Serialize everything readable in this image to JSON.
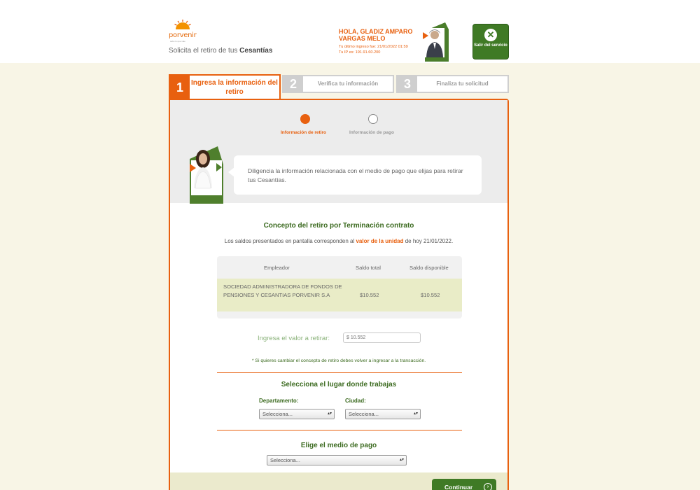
{
  "header": {
    "logo_text": "porvenir",
    "logo_tagline": "sabe lo que vale",
    "subtitle_prefix": "Solicita el retiro de tus ",
    "subtitle_bold": "Cesantías",
    "greeting_name": "Hola, GLADIZ AMPARO VARGAS MELO",
    "last_login": "Tu último ingreso fue: 21/01/2022 01:59",
    "ip": "Tu IP es: 191.91.60.200",
    "exit_label": "Salir del servicio"
  },
  "steps": [
    {
      "num": "1",
      "label": "Ingresa la información del retiro"
    },
    {
      "num": "2",
      "label": "Verifica tu información"
    },
    {
      "num": "3",
      "label": "Finaliza tu solicitud"
    }
  ],
  "progress": {
    "step_a": "Información de retiro",
    "step_b": "Información de pago"
  },
  "bubble_text": "Diligencia la información relacionada con el medio de pago que elijas para retirar tus Cesantías.",
  "concepto_title": "Concepto del retiro por Terminación contrato",
  "saldos_note": {
    "prefix": "Los saldos presentados en pantalla corresponden al ",
    "highlight": "valor de la unidad",
    "suffix": " de hoy 21/01/2022."
  },
  "table": {
    "headers": [
      "Empleador",
      "Saldo total",
      "Saldo disponible"
    ],
    "rows": [
      {
        "empleador": "SOCIEDAD ADMINISTRADORA DE FONDOS DE PENSIONES Y CESANTIAS PORVENIR S.A",
        "saldo_total": "$10.552",
        "saldo_disponible": "$10.552"
      }
    ]
  },
  "valor": {
    "label": "Ingresa el valor a retirar:",
    "placeholder": "$ 10.552"
  },
  "concepto_note": "* Si quieres cambiar el concepto de retiro debes volver a ingresar a la transacción.",
  "lugar": {
    "title": "Selecciona el lugar donde trabajas",
    "departamento_label": "Departamento:",
    "departamento_value": "Selecciona...",
    "ciudad_label": "Ciudad:",
    "ciudad_value": "Selecciona..."
  },
  "medio": {
    "title": "Elige el medio de pago",
    "value": "Selecciona..."
  },
  "continue_label": "Continuar",
  "colors": {
    "brand_orange": "#e8600f",
    "brand_green": "#3f7a25",
    "page_bg": "#f8f5e6"
  }
}
